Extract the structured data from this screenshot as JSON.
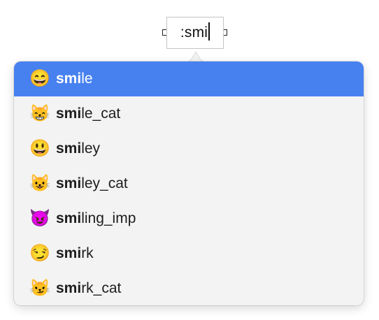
{
  "field": {
    "text": ":smi"
  },
  "suggestions": [
    {
      "icon": "grinning-face-icon",
      "glyph": "😄",
      "match": "smi",
      "rest": "le",
      "selected": true
    },
    {
      "icon": "smiling-cat-icon",
      "glyph": "😸",
      "match": "smi",
      "rest": "le_cat",
      "selected": false
    },
    {
      "icon": "smiley-face-icon",
      "glyph": "😃",
      "match": "smi",
      "rest": "ley",
      "selected": false
    },
    {
      "icon": "smiley-cat-icon",
      "glyph": "😺",
      "match": "smi",
      "rest": "ley_cat",
      "selected": false
    },
    {
      "icon": "smiling-imp-icon",
      "glyph": "😈",
      "match": "smi",
      "rest": "ling_imp",
      "selected": false
    },
    {
      "icon": "smirk-face-icon",
      "glyph": "😏",
      "match": "smi",
      "rest": "rk",
      "selected": false
    },
    {
      "icon": "smirk-cat-icon",
      "glyph": "😼",
      "match": "smi",
      "rest": "rk_cat",
      "selected": false
    }
  ],
  "colors": {
    "selection": "#4781f0",
    "popover_bg": "#f3f3f3"
  }
}
